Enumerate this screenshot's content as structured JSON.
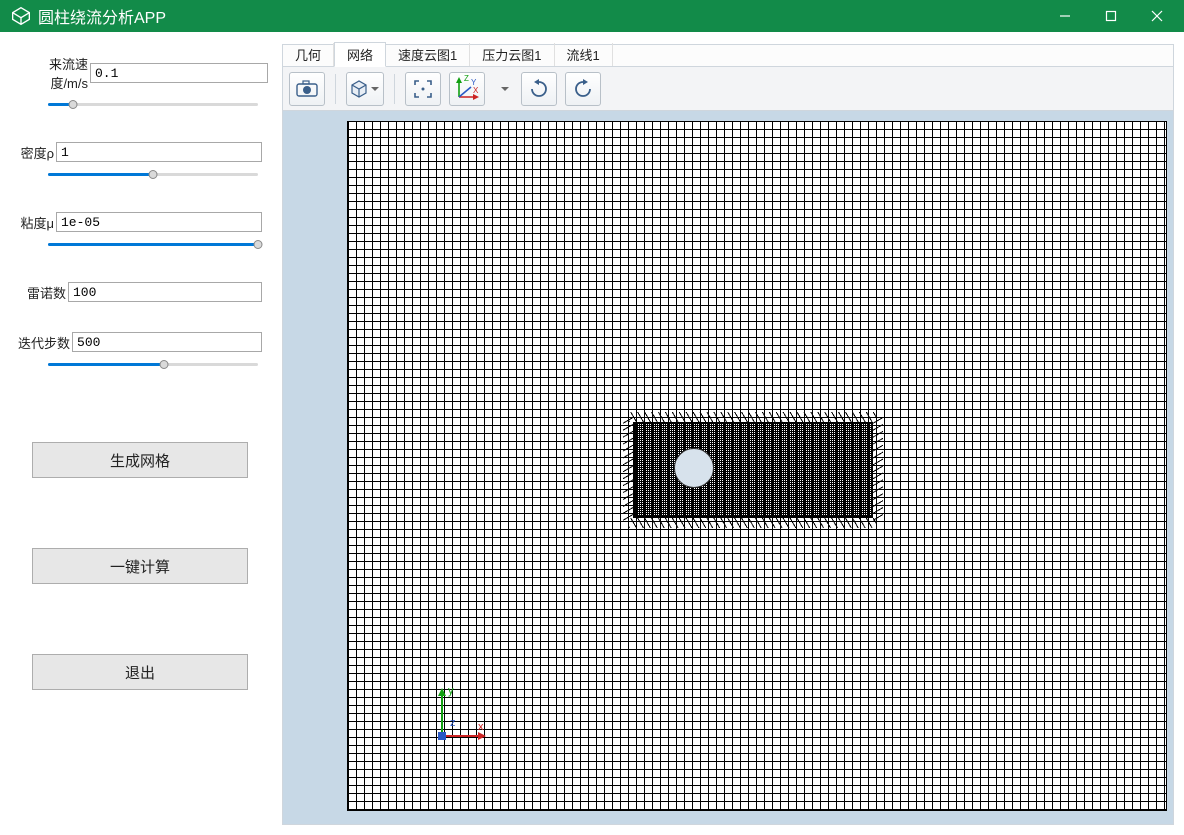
{
  "window": {
    "title": "圆柱绕流分析APP"
  },
  "params": {
    "velocity": {
      "label": "来流速度/m/s",
      "value": "0.1",
      "slider_pct": 12
    },
    "density": {
      "label": "密度ρ",
      "value": "1",
      "slider_pct": 50
    },
    "viscosity": {
      "label": "粘度μ",
      "value": "1e-05",
      "slider_pct": 100
    },
    "reynolds": {
      "label": "雷诺数",
      "value": "100"
    },
    "iterations": {
      "label": "迭代步数",
      "value": "500",
      "slider_pct": 55
    }
  },
  "buttons": {
    "generate_mesh": "生成网格",
    "one_click_compute": "一键计算",
    "exit": "退出"
  },
  "tabs": {
    "items": [
      {
        "label": "几何",
        "active": false
      },
      {
        "label": "网络",
        "active": true
      },
      {
        "label": "速度云图1",
        "active": false
      },
      {
        "label": "压力云图1",
        "active": false
      },
      {
        "label": "流线1",
        "active": false
      }
    ]
  },
  "orientation": {
    "x": "x",
    "y": "y",
    "z": "z"
  },
  "axis_gizmo": {
    "x": "X",
    "y": "Y",
    "z": "Z"
  }
}
